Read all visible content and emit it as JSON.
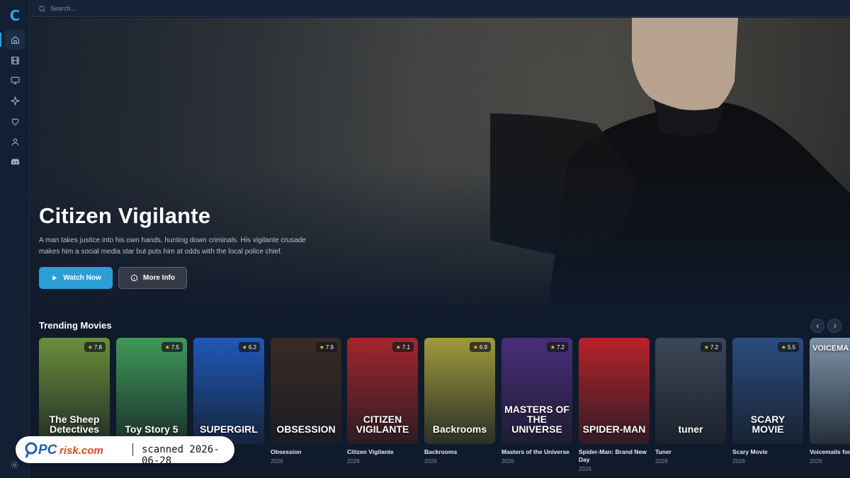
{
  "app": {
    "logo_letter": "C",
    "accent": "#2aa3e0"
  },
  "search": {
    "placeholder": "Search..."
  },
  "sidebar": {
    "items": [
      {
        "name": "home",
        "icon": "home-icon",
        "active": true
      },
      {
        "name": "movies",
        "icon": "film-icon"
      },
      {
        "name": "tv",
        "icon": "tv-icon"
      },
      {
        "name": "discover",
        "icon": "sparkle-icon"
      },
      {
        "name": "favorites",
        "icon": "heart-icon"
      },
      {
        "name": "profile",
        "icon": "user-icon"
      },
      {
        "name": "discord",
        "icon": "discord-icon"
      }
    ],
    "settings_icon": "gear-icon"
  },
  "hero": {
    "title": "Citizen Vigilante",
    "description": "A man takes justice into his own hands, hunting down criminals. His vigilante crusade makes him a social media star but puts him at odds with the local police chief.",
    "watch_label": "Watch Now",
    "info_label": "More Info"
  },
  "trending": {
    "title": "Trending Movies",
    "movies": [
      {
        "title": "",
        "year": "",
        "rating": "7.8",
        "poster_text": "The Sheep Detectives",
        "color": "#6b8f3a"
      },
      {
        "title": "",
        "year": "",
        "rating": "7.5",
        "poster_text": "Toy Story 5",
        "color": "#3f9a58"
      },
      {
        "title": "",
        "year": "",
        "rating": "6.2",
        "poster_text": "SUPERGIRL",
        "color": "#1f58b8"
      },
      {
        "title": "Obsession",
        "year": "2026",
        "rating": "7.9",
        "poster_text": "OBSESSION",
        "color": "#3a2a24"
      },
      {
        "title": "Citizen Vigilante",
        "year": "2026",
        "rating": "7.1",
        "poster_text": "CITIZEN VIGILANTE",
        "color": "#a3262b"
      },
      {
        "title": "Backrooms",
        "year": "2026",
        "rating": "6.9",
        "poster_text": "Backrooms",
        "color": "#9f9a3a"
      },
      {
        "title": "Masters of the Universe",
        "year": "2026",
        "rating": "7.2",
        "poster_text": "MASTERS OF THE UNIVERSE",
        "color": "#4a2d7a"
      },
      {
        "title": "Spider-Man: Brand New Day",
        "year": "2026",
        "rating": "",
        "poster_text": "SPIDER-MAN",
        "color": "#b8222a"
      },
      {
        "title": "Tuner",
        "year": "2026",
        "rating": "7.2",
        "poster_text": "tuner",
        "color": "#3b4656"
      },
      {
        "title": "Scary Movie",
        "year": "2026",
        "rating": "5.5",
        "poster_text": "SCARY MOVIE",
        "color": "#2b4c7e"
      },
      {
        "title": "Voicemails for Isabelle",
        "year": "2026",
        "rating": "",
        "poster_text": "VOICEMA",
        "color": "#7d94a8"
      }
    ]
  },
  "watermark": {
    "brand": "PCrisk.com",
    "text": "scanned 2026-06-28"
  }
}
